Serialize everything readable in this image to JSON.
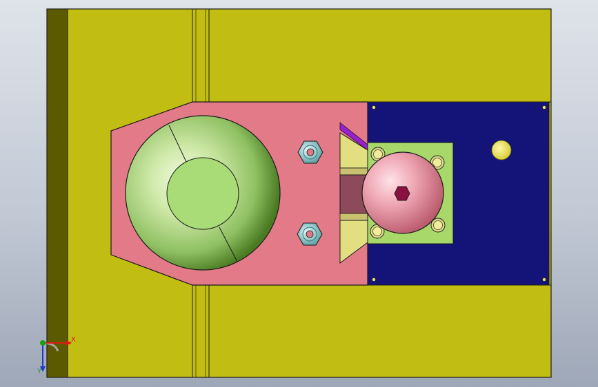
{
  "viewport": {
    "background_top": "#dfe3ea",
    "background_bottom": "#9ea7b7"
  },
  "model": {
    "colors": {
      "base_plate": "#c2bd12",
      "base_shadow": "#5c5a00",
      "slider_block": "#e27a88",
      "clamp_plate": "#141478",
      "cam_plate": "#a8d76a",
      "cam_body": "#efa5b2",
      "pivot_body": "#b8df8a",
      "nut": "#9bcfd2",
      "wedge": "#e2df80",
      "gib": "#8d4a5a",
      "edge": "#1a1a1a"
    },
    "components": [
      "base-plate",
      "slider-block",
      "clamp-plate",
      "pivot-dome",
      "cam-disc",
      "hex-nut-top",
      "hex-nut-bottom",
      "wedge-top",
      "wedge-bottom",
      "gib-guide",
      "dowel-pin"
    ]
  },
  "triad": {
    "x_label": "X",
    "y_label": "Y",
    "x_color": "#e01818",
    "y_color": "#18a018",
    "z_color": "#2038d0"
  }
}
